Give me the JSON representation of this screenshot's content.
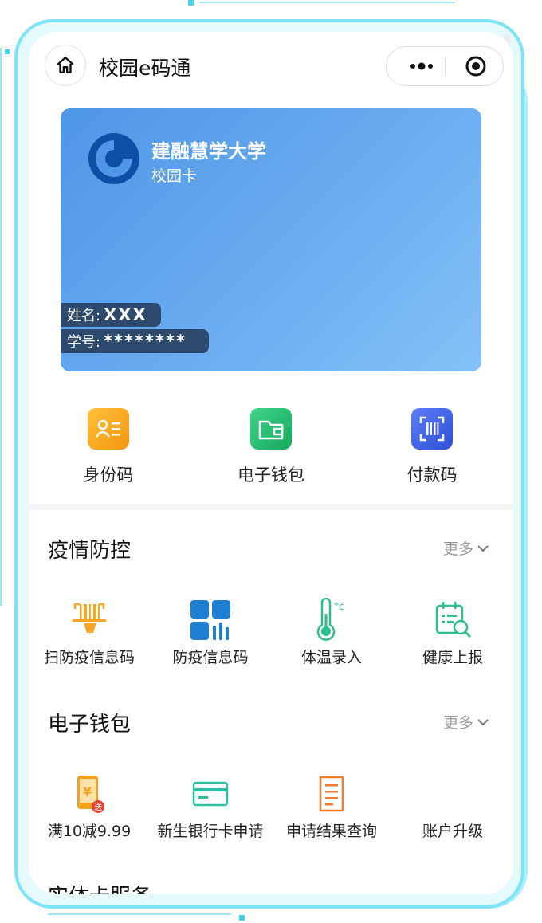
{
  "nav": {
    "title": "校园e码通",
    "home_icon": "home-icon",
    "more_icon": "more-dots-icon",
    "close_icon": "record-close-icon"
  },
  "card": {
    "bank_name": "建融慧学大学",
    "card_type": "校园卡",
    "name_label": "姓名:",
    "name_value": "XXX",
    "id_label": "学号:",
    "id_value": "********",
    "logo_icon": "bank-logo-icon"
  },
  "quick_actions": [
    {
      "label": "身份码",
      "icon": "id-card-icon",
      "color": "#f5a11d"
    },
    {
      "label": "电子钱包",
      "icon": "wallet-icon",
      "color": "#22b86a"
    },
    {
      "label": "付款码",
      "icon": "barcode-scan-icon",
      "color": "#4361e8"
    }
  ],
  "sections": [
    {
      "title": "疫情防控",
      "more": "更多",
      "items": [
        {
          "label": "扫防疫信息码",
          "icon": "scan-barcode-icon"
        },
        {
          "label": "防疫信息码",
          "icon": "qr-grid-icon"
        },
        {
          "label": "体温录入",
          "icon": "thermometer-icon"
        },
        {
          "label": "健康上报",
          "icon": "calendar-search-icon"
        }
      ]
    },
    {
      "title": "电子钱包",
      "more": "更多",
      "items": [
        {
          "label": "满10减9.99",
          "icon": "phone-coupon-icon"
        },
        {
          "label": "新生银行卡申请",
          "icon": "bank-card-icon"
        },
        {
          "label": "申请结果查询",
          "icon": "document-icon"
        },
        {
          "label": "账户升级",
          "icon": ""
        }
      ]
    }
  ],
  "partial_section_title": "实体卡服务"
}
